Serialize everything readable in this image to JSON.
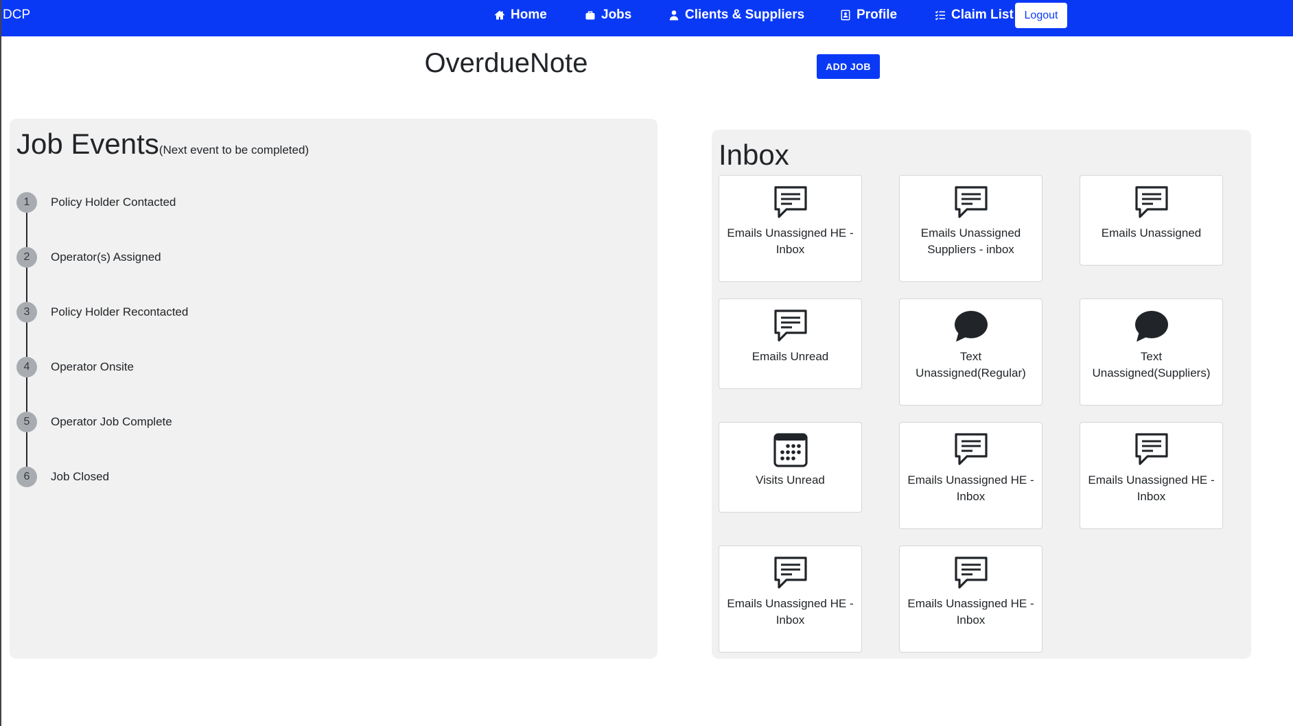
{
  "navbar": {
    "brand": "DCP",
    "items": [
      {
        "label": "Home",
        "icon": "home-icon"
      },
      {
        "label": "Jobs",
        "icon": "briefcase-icon"
      },
      {
        "label": "Clients & Suppliers",
        "icon": "person-icon"
      },
      {
        "label": "Profile",
        "icon": "profile-icon"
      },
      {
        "label": "Claim List",
        "icon": "list-check-icon"
      }
    ],
    "logout_label": "Logout"
  },
  "header": {
    "title": "OverdueNote",
    "add_job_label": "ADD JOB"
  },
  "job_events": {
    "title": "Job Events",
    "subtitle": "(Next event to be completed)",
    "steps": [
      {
        "number": "1",
        "label": "Policy Holder Contacted"
      },
      {
        "number": "2",
        "label": "Operator(s) Assigned"
      },
      {
        "number": "3",
        "label": "Policy Holder Recontacted"
      },
      {
        "number": "4",
        "label": "Operator Onsite"
      },
      {
        "number": "5",
        "label": "Operator Job Complete"
      },
      {
        "number": "6",
        "label": "Job Closed"
      }
    ]
  },
  "inbox": {
    "title": "Inbox",
    "tiles": [
      {
        "label": "Emails Unassigned HE - Inbox",
        "icon": "message-square-icon"
      },
      {
        "label": "Emails Unassigned Suppliers - inbox",
        "icon": "message-square-icon"
      },
      {
        "label": "Emails Unassigned",
        "icon": "message-square-icon"
      },
      {
        "label": "Emails Unread",
        "icon": "message-square-icon"
      },
      {
        "label": "Text Unassigned(Regular)",
        "icon": "chat-bubble-icon"
      },
      {
        "label": "Text Unassigned(Suppliers)",
        "icon": "chat-bubble-icon"
      },
      {
        "label": "Visits Unread",
        "icon": "calendar-icon"
      },
      {
        "label": "Emails Unassigned HE - Inbox",
        "icon": "message-square-icon"
      },
      {
        "label": "Emails Unassigned HE - Inbox",
        "icon": "message-square-icon"
      },
      {
        "label": "Emails Unassigned HE - Inbox",
        "icon": "message-square-icon"
      },
      {
        "label": "Emails Unassigned HE - Inbox",
        "icon": "message-square-icon"
      }
    ]
  },
  "colors": {
    "primary": "#0a39f6",
    "panel_background": "#f1f1f1",
    "step_circle": "#a8acb1",
    "text": "#212529"
  }
}
